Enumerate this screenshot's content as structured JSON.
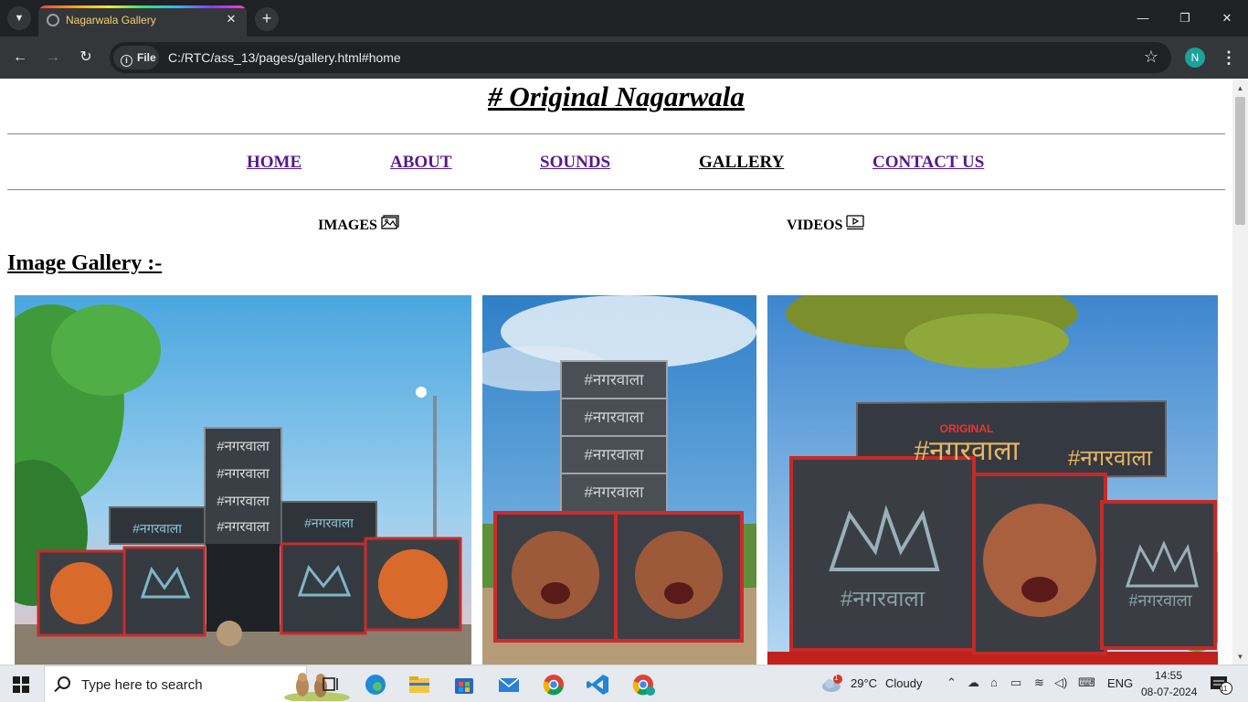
{
  "browser": {
    "tab_title": "Nagarwala Gallery",
    "url_chip": "File",
    "url": "C:/RTC/ass_13/pages/gallery.html#home",
    "profile_initial": "N"
  },
  "page": {
    "site_title": "# Original Nagarwala",
    "nav": [
      {
        "label": "HOME"
      },
      {
        "label": "ABOUT"
      },
      {
        "label": "SOUNDS"
      },
      {
        "label": "GALLERY"
      },
      {
        "label": "CONTACT US"
      }
    ],
    "sub_nav": {
      "images_label": "IMAGES",
      "videos_label": "VIDEOS"
    },
    "gallery_heading": "Image Gallery :-",
    "photo_text": {
      "speaker_brand": "#नगरवाला",
      "badge": "ORIGINAL"
    }
  },
  "taskbar": {
    "search_placeholder": "Type here to search",
    "weather_temp": "29°C",
    "weather_desc": "Cloudy",
    "weather_badge": "1",
    "language": "ENG",
    "time": "14:55",
    "date": "08-07-2024",
    "notification_count": "11"
  },
  "colors": {
    "link_visited": "#551a8b",
    "tab_title": "#f0d36a",
    "chrome_dark": "#202124",
    "chrome_toolbar": "#35363a"
  }
}
